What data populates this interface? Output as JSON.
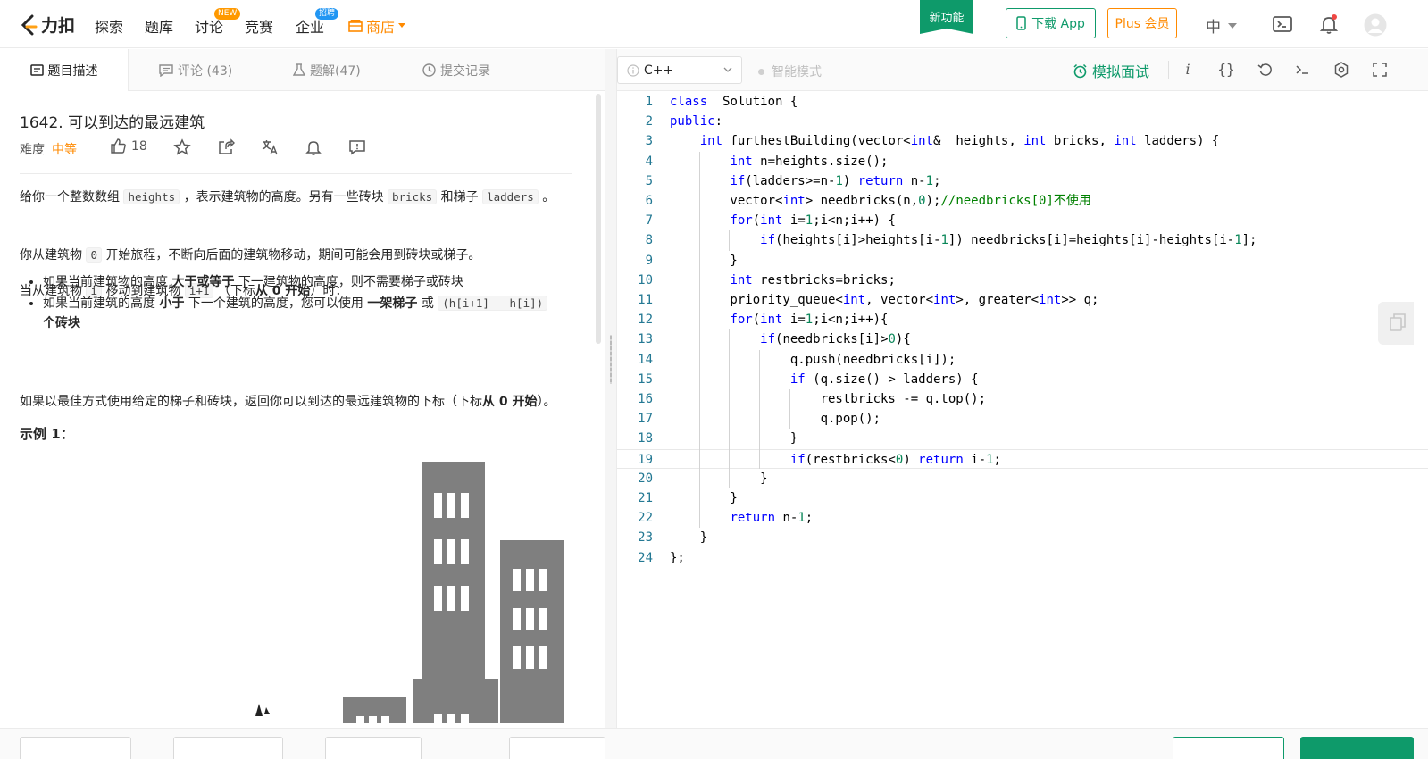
{
  "topnav": {
    "logo_text": "力扣",
    "items": [
      {
        "label": "探索"
      },
      {
        "label": "题库"
      },
      {
        "label": "讨论",
        "badge": "NEW"
      },
      {
        "label": "竞赛"
      },
      {
        "label": "企业",
        "badge": "招聘"
      }
    ],
    "store_label": "商店",
    "new_feature": "新功能",
    "download_app": "下载 App",
    "plus_member": "Plus 会员",
    "language": "中"
  },
  "left_tabs": [
    {
      "label": "题目描述",
      "icon": "description-icon",
      "active": true
    },
    {
      "label": "评论 (43)",
      "icon": "comment-icon"
    },
    {
      "label": "题解(47)",
      "icon": "flask-icon"
    },
    {
      "label": "提交记录",
      "icon": "clock-icon"
    }
  ],
  "problem": {
    "title": "1642. 可以到达的最远建筑",
    "difficulty_label": "难度",
    "difficulty": "中等",
    "likes": "18",
    "p1_a": "给你一个整数数组",
    "p1_code1": "heights",
    "p1_b": "，表示建筑物的高度。另有一些砖块",
    "p1_code2": "bricks",
    "p1_c": "和梯子",
    "p1_code3": "ladders",
    "p1_d": "。",
    "p2_a": "你从建筑物",
    "p2_code": "0",
    "p2_b": "开始旅程，不断向后面的建筑物移动，期间可能会用到砖块或梯子。",
    "p3_a": "当从建筑物",
    "p3_code1": "i",
    "p3_b": "移动到建筑物",
    "p3_code2": "i+1",
    "p3_c": "（下标",
    "p3_bold": "从 0 开始",
    "p3_d": "）时：",
    "b1_a": "如果当前建筑物的高度",
    "b1_bold": "大于或等于",
    "b1_b": "下一建筑物的高度，则不需要梯子或砖块",
    "b2_a": "如果当前建筑的高度",
    "b2_bold1": "小于",
    "b2_b": "下一个建筑的高度，您可以使用",
    "b2_bold2": "一架梯子",
    "b2_c": "或",
    "b2_code": "(h[i+1] - h[i])",
    "b2_bold3": "个砖块",
    "p4_a": "如果以最佳方式使用给定的梯子和砖块，返回你可以到达的最远建筑物的下标（下标",
    "p4_bold": "从 0 开始",
    "p4_b": "）。",
    "example_title": "示例 1："
  },
  "editor": {
    "language": "C++",
    "smart_mode": "智能模式",
    "mock_interview": "模拟面试",
    "active_line": 19,
    "lines": [
      [
        [
          "kw",
          "class"
        ],
        [
          "",
          "  Solution {"
        ]
      ],
      [
        [
          "kw",
          "public"
        ],
        [
          "",
          ":"
        ]
      ],
      [
        [
          "",
          "    "
        ],
        [
          "kw",
          "int"
        ],
        [
          "",
          " furthestBuilding(vector<"
        ],
        [
          "kw",
          "int"
        ],
        [
          "",
          "&  heights, "
        ],
        [
          "kw",
          "int"
        ],
        [
          "",
          " bricks, "
        ],
        [
          "kw",
          "int"
        ],
        [
          "",
          " ladders) {"
        ]
      ],
      [
        [
          "",
          "        "
        ],
        [
          "kw",
          "int"
        ],
        [
          "",
          " n=heights.size();"
        ]
      ],
      [
        [
          "",
          "        "
        ],
        [
          "kw",
          "if"
        ],
        [
          "",
          "(ladders>=n-"
        ],
        [
          "num",
          "1"
        ],
        [
          "",
          ") "
        ],
        [
          "kw",
          "return"
        ],
        [
          "",
          " n-"
        ],
        [
          "num",
          "1"
        ],
        [
          "",
          ";"
        ]
      ],
      [
        [
          "",
          "        vector<"
        ],
        [
          "kw",
          "int"
        ],
        [
          "",
          "> needbricks(n,"
        ],
        [
          "num",
          "0"
        ],
        [
          "",
          ");"
        ],
        [
          "cm",
          "//needbricks[0]不使用"
        ]
      ],
      [
        [
          "",
          "        "
        ],
        [
          "kw",
          "for"
        ],
        [
          "",
          "("
        ],
        [
          "kw",
          "int"
        ],
        [
          "",
          " i="
        ],
        [
          "num",
          "1"
        ],
        [
          "",
          ";i<n;i++) {"
        ]
      ],
      [
        [
          "",
          "            "
        ],
        [
          "kw",
          "if"
        ],
        [
          "",
          "(heights[i]>heights[i-"
        ],
        [
          "num",
          "1"
        ],
        [
          "",
          "]) needbricks[i]=heights[i]-heights[i-"
        ],
        [
          "num",
          "1"
        ],
        [
          "",
          "];"
        ]
      ],
      [
        [
          "",
          "        }"
        ]
      ],
      [
        [
          "",
          "        "
        ],
        [
          "kw",
          "int"
        ],
        [
          "",
          " restbricks=bricks;"
        ]
      ],
      [
        [
          "",
          "        priority_queue<"
        ],
        [
          "kw",
          "int"
        ],
        [
          "",
          ", vector<"
        ],
        [
          "kw",
          "int"
        ],
        [
          "",
          ">, greater<"
        ],
        [
          "kw",
          "int"
        ],
        [
          "",
          ">> q;"
        ]
      ],
      [
        [
          "",
          "        "
        ],
        [
          "kw",
          "for"
        ],
        [
          "",
          "("
        ],
        [
          "kw",
          "int"
        ],
        [
          "",
          " i="
        ],
        [
          "num",
          "1"
        ],
        [
          "",
          ";i<n;i++){"
        ]
      ],
      [
        [
          "",
          "            "
        ],
        [
          "kw",
          "if"
        ],
        [
          "",
          "(needbricks[i]>"
        ],
        [
          "num",
          "0"
        ],
        [
          "",
          "){"
        ]
      ],
      [
        [
          "",
          "                q.push(needbricks[i]);"
        ]
      ],
      [
        [
          "",
          "                "
        ],
        [
          "kw",
          "if"
        ],
        [
          "",
          " (q.size() > ladders) {"
        ]
      ],
      [
        [
          "",
          "                    restbricks -= q.top();"
        ]
      ],
      [
        [
          "",
          "                    q.pop();"
        ]
      ],
      [
        [
          "",
          "                }"
        ]
      ],
      [
        [
          "",
          "                "
        ],
        [
          "kw",
          "if"
        ],
        [
          "",
          "(restbricks<"
        ],
        [
          "num",
          "0"
        ],
        [
          "",
          ") "
        ],
        [
          "kw",
          "return"
        ],
        [
          "",
          " i-"
        ],
        [
          "num",
          "1"
        ],
        [
          "",
          ";"
        ]
      ],
      [
        [
          "",
          "            }"
        ]
      ],
      [
        [
          "",
          "        }"
        ]
      ],
      [
        [
          "",
          "        "
        ],
        [
          "kw",
          "return"
        ],
        [
          "",
          " n-"
        ],
        [
          "num",
          "1"
        ],
        [
          "",
          ";"
        ]
      ],
      [
        [
          "",
          "    }"
        ]
      ],
      [
        [
          "",
          "};"
        ]
      ]
    ]
  },
  "colors": {
    "accent_green": "#0e9a6a",
    "accent_orange": "#ff8a00",
    "keyword": "#0000ff",
    "number": "#098658",
    "comment": "#008000",
    "line_number": "#237893"
  }
}
